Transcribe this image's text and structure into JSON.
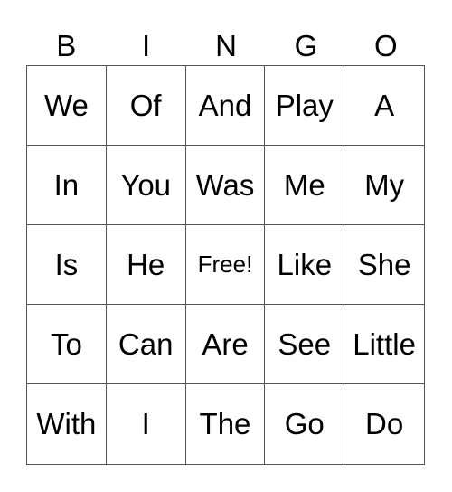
{
  "header": [
    "B",
    "I",
    "N",
    "G",
    "O"
  ],
  "free_label": "Free!",
  "grid": [
    [
      "We",
      "Of",
      "And",
      "Play",
      "A"
    ],
    [
      "In",
      "You",
      "Was",
      "Me",
      "My"
    ],
    [
      "Is",
      "He",
      "Free!",
      "Like",
      "She"
    ],
    [
      "To",
      "Can",
      "Are",
      "See",
      "Little"
    ],
    [
      "With",
      "I",
      "The",
      "Go",
      "Do"
    ]
  ]
}
